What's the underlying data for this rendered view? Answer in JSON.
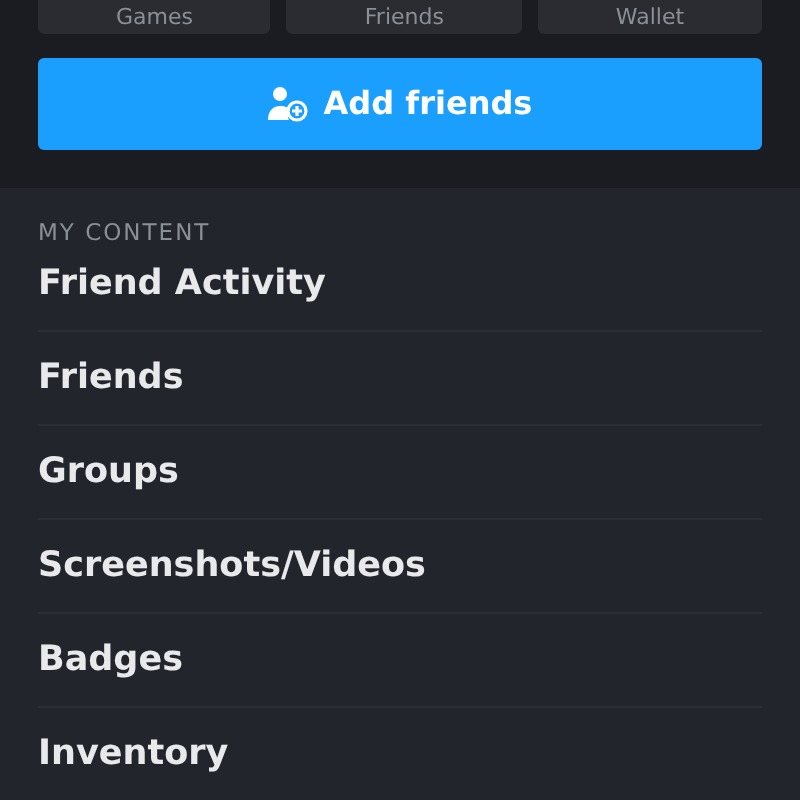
{
  "shortcuts": [
    {
      "label": "Games"
    },
    {
      "label": "Friends"
    },
    {
      "label": "Wallet"
    }
  ],
  "add_button": {
    "label": "Add friends"
  },
  "section": {
    "heading": "MY CONTENT",
    "items": [
      {
        "label": "Friend Activity"
      },
      {
        "label": "Friends"
      },
      {
        "label": "Groups"
      },
      {
        "label": "Screenshots/Videos"
      },
      {
        "label": "Badges"
      },
      {
        "label": "Inventory"
      }
    ]
  }
}
